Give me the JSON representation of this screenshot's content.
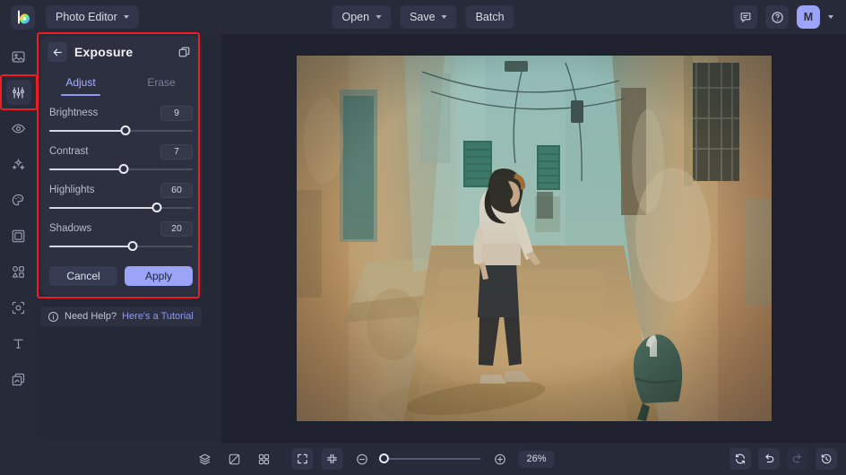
{
  "app": {
    "logo_icon": "brand-color-wheel-logo",
    "workspace_label": "Photo Editor"
  },
  "topbar": {
    "open_label": "Open",
    "save_label": "Save",
    "batch_label": "Batch",
    "feedback_icon": "comment-icon",
    "help_icon": "question-circle-icon",
    "avatar_initial": "M"
  },
  "sidebar": {
    "items": [
      {
        "name": "sidebar-item-image",
        "icon": "image-icon",
        "active": false
      },
      {
        "name": "sidebar-item-adjust",
        "icon": "sliders-icon",
        "active": true
      },
      {
        "name": "sidebar-item-retouch",
        "icon": "eye-icon",
        "active": false
      },
      {
        "name": "sidebar-item-effects",
        "icon": "sparkles-icon",
        "active": false
      },
      {
        "name": "sidebar-item-color",
        "icon": "palette-icon",
        "active": false
      },
      {
        "name": "sidebar-item-frame",
        "icon": "frame-icon",
        "active": false
      },
      {
        "name": "sidebar-item-shapes",
        "icon": "shapes-icon",
        "active": false
      },
      {
        "name": "sidebar-item-cutout",
        "icon": "cutout-icon",
        "active": false
      },
      {
        "name": "sidebar-item-text",
        "icon": "text-icon",
        "active": false
      },
      {
        "name": "sidebar-item-layers",
        "icon": "layers-copy-icon",
        "active": false
      }
    ]
  },
  "panel": {
    "back_icon": "arrow-left-icon",
    "title": "Exposure",
    "popout_icon": "popout-window-icon",
    "tabs": [
      {
        "label": "Adjust",
        "active": true
      },
      {
        "label": "Erase",
        "active": false
      }
    ],
    "sliders": [
      {
        "label": "Brightness",
        "value": "9",
        "percent": 53
      },
      {
        "label": "Contrast",
        "value": "7",
        "percent": 52
      },
      {
        "label": "Highlights",
        "value": "60",
        "percent": 75
      },
      {
        "label": "Shadows",
        "value": "20",
        "percent": 58
      }
    ],
    "cancel_label": "Cancel",
    "apply_label": "Apply",
    "highlight_color": "#ee1d22"
  },
  "help_bar": {
    "info_icon": "info-circle-icon",
    "prompt": "Need Help?",
    "link_label": "Here's a Tutorial"
  },
  "canvas": {
    "photo_alt": "Woman standing in sunlit narrow alley with teal walls and a backpack"
  },
  "bottombar": {
    "left_tools": [
      {
        "name": "layers-button",
        "icon": "stack-layers-icon"
      },
      {
        "name": "compare-button",
        "icon": "compare-split-icon"
      },
      {
        "name": "grid-button",
        "icon": "grid-four-icon"
      }
    ],
    "center_tools": [
      {
        "name": "fit-screen-button",
        "icon": "expand-frame-icon"
      },
      {
        "name": "actual-size-button",
        "icon": "collapse-frame-icon"
      }
    ],
    "zoom_out_icon": "minus-circle-icon",
    "zoom_in_icon": "plus-circle-icon",
    "zoom_value": "26%",
    "zoom_percent": 4,
    "right_tools": [
      {
        "name": "reset-button",
        "icon": "reset-refresh-icon",
        "enabled": true
      },
      {
        "name": "undo-button",
        "icon": "undo-arrow-icon",
        "enabled": true
      },
      {
        "name": "redo-button",
        "icon": "redo-arrow-icon",
        "enabled": false
      },
      {
        "name": "history-button",
        "icon": "clock-history-icon",
        "enabled": true
      }
    ]
  },
  "colors": {
    "accent": "#9ca4f7",
    "panel_bg": "#2d3040",
    "chrome_bg": "#272a38",
    "canvas_bg": "#20232f",
    "marker_red": "#ee1d22"
  }
}
